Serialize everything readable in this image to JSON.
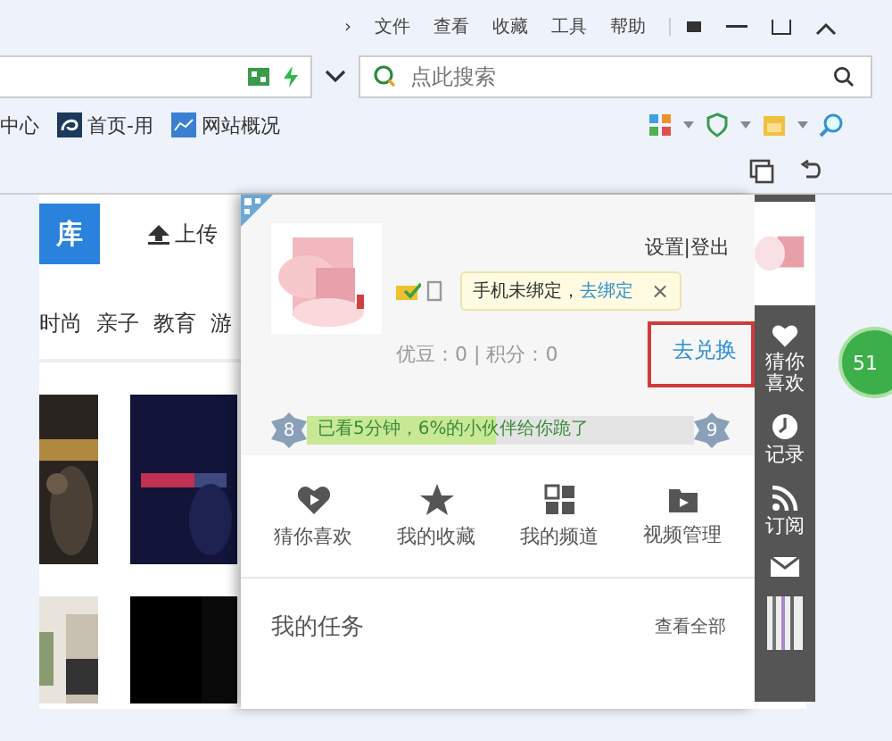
{
  "menu": {
    "chevron": "›",
    "items": [
      "文件",
      "查看",
      "收藏",
      "工具",
      "帮助"
    ]
  },
  "search": {
    "placeholder": "点此搜索"
  },
  "bookmarks": [
    {
      "label": "中心",
      "kind": "plain"
    },
    {
      "label": "首页-用",
      "kind": "swirl"
    },
    {
      "label": "网站概况",
      "kind": "chart"
    }
  ],
  "page": {
    "library_button": "库",
    "upload": "上传",
    "categories": [
      "时尚",
      "亲子",
      "教育",
      "游"
    ]
  },
  "panel": {
    "settings": "设置",
    "separator": "|",
    "logout": "登出",
    "phone_tip": "手机未绑定，",
    "bind_link": "去绑定",
    "tip_close": "×",
    "points": "优豆：0 | 积分：0",
    "redeem": "去兑换",
    "progress": {
      "current": "8",
      "next": "9",
      "text": "已看5分钟，6%的小伙伴给你跪了",
      "level": 0.49
    },
    "shortcuts": [
      {
        "label": "猜你喜欢",
        "kind": "heart"
      },
      {
        "label": "我的收藏",
        "kind": "star"
      },
      {
        "label": "我的频道",
        "kind": "grid"
      },
      {
        "label": "视频管理",
        "kind": "folder"
      }
    ],
    "tasks": {
      "title": "我的任务",
      "view_all": "查看全部"
    }
  },
  "sidebar": [
    {
      "label": "猜你喜欢",
      "kind": "heart"
    },
    {
      "label": "记录",
      "kind": "clock"
    },
    {
      "label": "订阅",
      "kind": "rss"
    },
    {
      "kind": "mail"
    }
  ],
  "badge": "51"
}
